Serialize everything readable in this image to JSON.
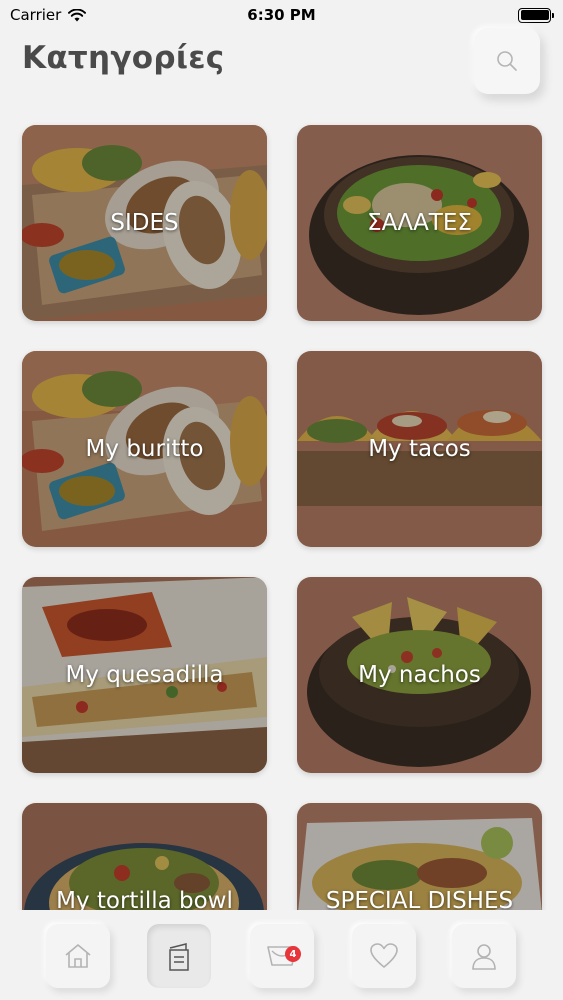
{
  "status_bar": {
    "carrier": "Carrier",
    "time": "6:30 PM"
  },
  "header": {
    "title": "Κατηγορίες",
    "search_icon": "search-icon"
  },
  "categories": [
    {
      "label": "SIDES",
      "image": "burrito-platter"
    },
    {
      "label": "ΣΑΛΑΤΕΣ",
      "image": "salad-bowl"
    },
    {
      "label": "My buritto",
      "image": "burrito-platter"
    },
    {
      "label": "My tacos",
      "image": "tacos-board"
    },
    {
      "label": "My quesadilla",
      "image": "quesadilla-plate"
    },
    {
      "label": "My nachos",
      "image": "nachos-bowl"
    },
    {
      "label": "My tortilla bowl",
      "image": "tortilla-bowl"
    },
    {
      "label": "SPECIAL DISHES",
      "image": "special-dish"
    }
  ],
  "tab_bar": {
    "tabs": [
      {
        "icon": "home-icon"
      },
      {
        "icon": "menu-icon",
        "active": true
      },
      {
        "icon": "cart-icon",
        "badge": "4"
      },
      {
        "icon": "heart-icon"
      },
      {
        "icon": "profile-icon"
      }
    ]
  },
  "colors": {
    "background": "#f2f2f2",
    "title": "#4a4a4a",
    "badge": "#e8353b"
  }
}
